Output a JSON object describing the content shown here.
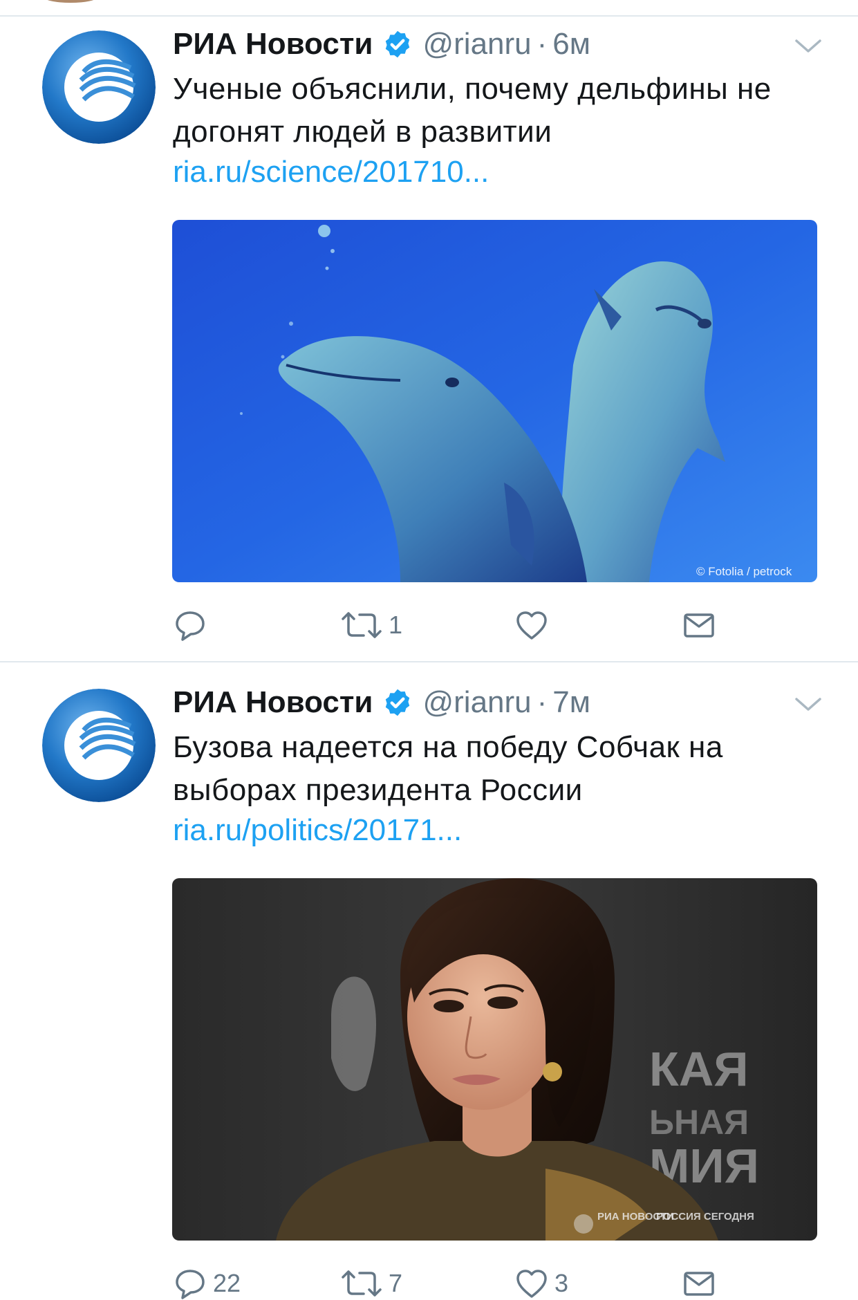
{
  "tweets": [
    {
      "name": "РИА Новости",
      "handle": "@rianru",
      "separator": "·",
      "time": "6м",
      "text": "Ученые объяснили, почему дельфины не догонят людей в развитии",
      "link": "ria.ru/science/201710...",
      "media": {
        "subject": "two dolphins underwater",
        "credit": "© Fotolia / petrock"
      },
      "actions": {
        "replies": "",
        "retweets": "1",
        "likes": "",
        "messages": ""
      }
    },
    {
      "name": "РИА Новости",
      "handle": "@rianru",
      "separator": "·",
      "time": "7м",
      "text": "Бузова надеется на победу Собчак на выборах президента России",
      "link": "ria.ru/politics/20171...",
      "media": {
        "subject": "woman with bob haircut at event",
        "watermark_top": "РИА НОВОСТИ",
        "watermark_right": "РОССИЯ СЕГОДНЯ"
      },
      "actions": {
        "replies": "22",
        "retweets": "7",
        "likes": "3",
        "messages": ""
      }
    }
  ],
  "colors": {
    "verified": "#1da1f2",
    "link": "#1da1f2",
    "muted": "#657786",
    "divider": "#e1e8ed",
    "icon": "#657786"
  },
  "icons": [
    "verified-icon",
    "chevron-down-icon",
    "reply-icon",
    "retweet-icon",
    "like-icon",
    "message-icon"
  ]
}
